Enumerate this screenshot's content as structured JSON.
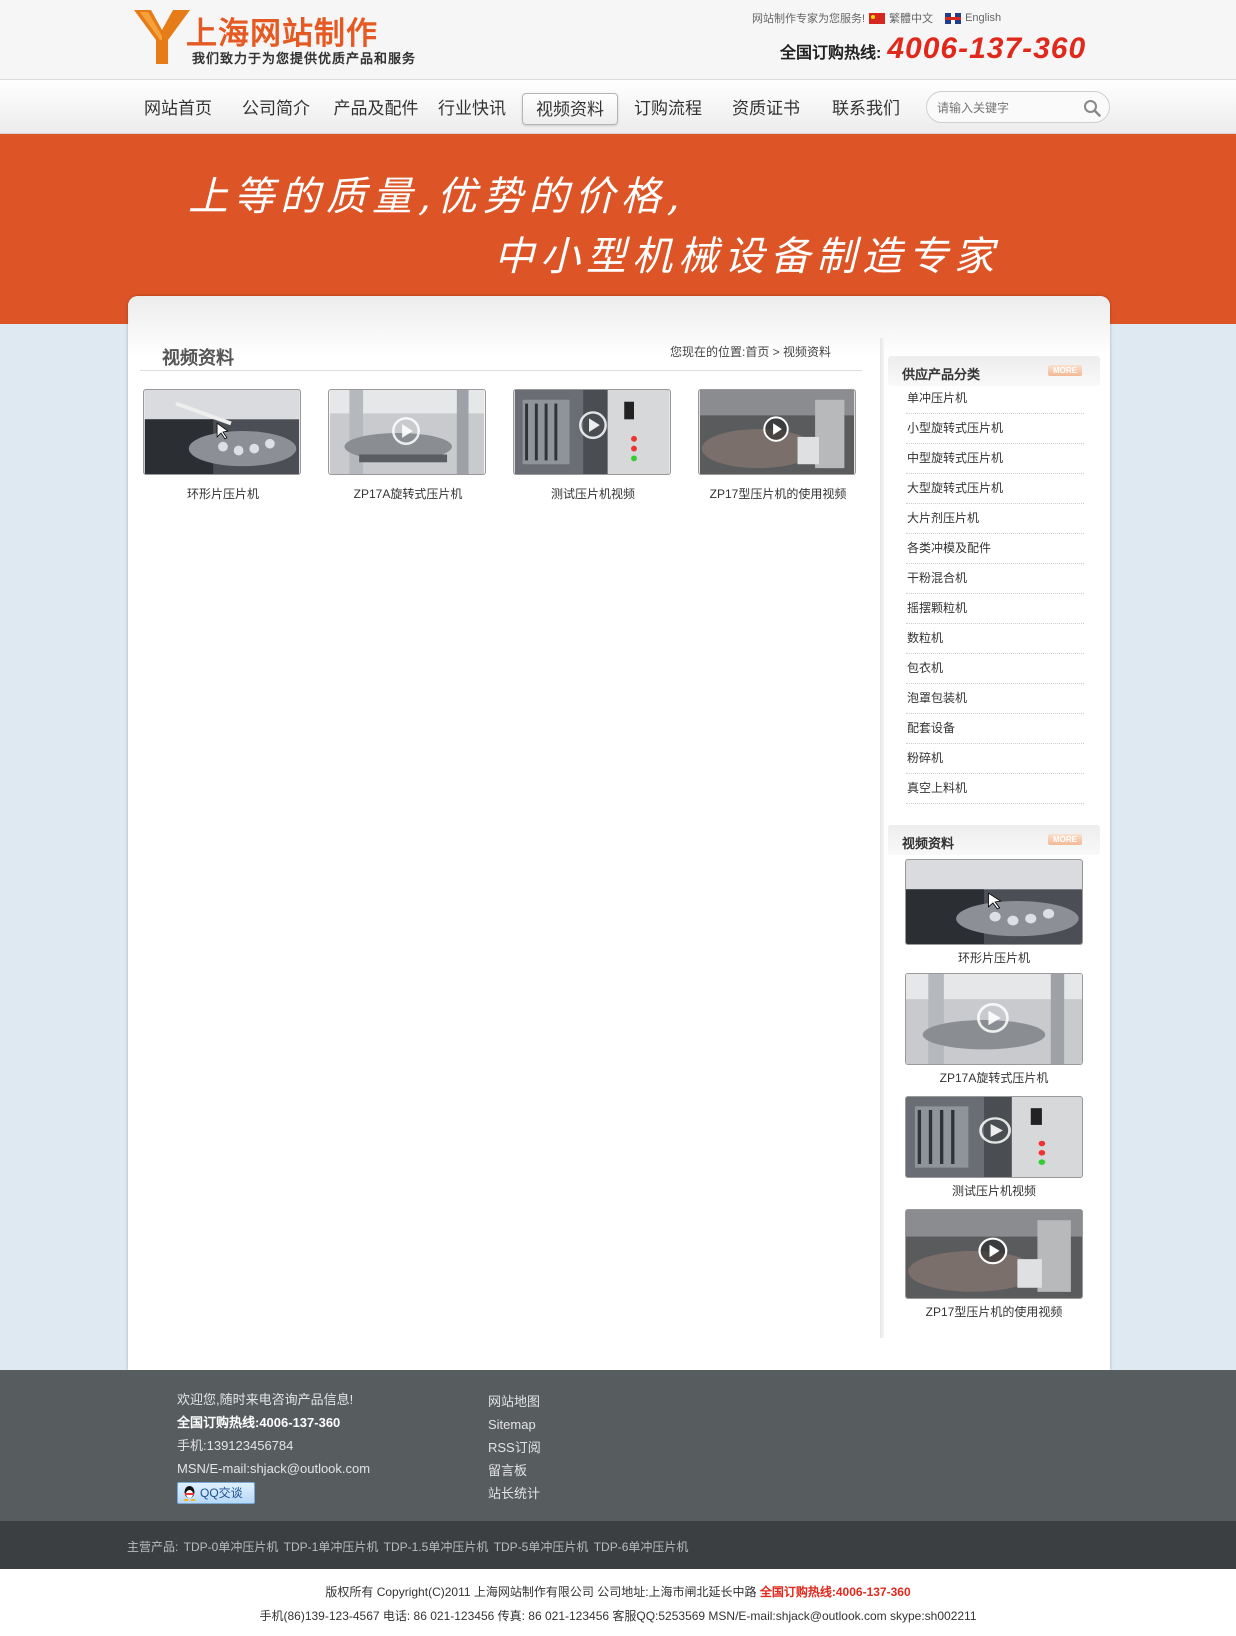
{
  "header": {
    "logo_title": "上海网站制作",
    "logo_sub": "我们致力于为您提供优质产品和服务",
    "service_text": "网站制作专家为您服务!",
    "lang_tc": "繁體中文",
    "lang_en": "English",
    "hotline_label": "全国订购热线:",
    "hotline_number": "4006-137-360"
  },
  "nav": {
    "items": [
      "网站首页",
      "公司简介",
      "产品及配件",
      "行业快讯",
      "视频资料",
      "订购流程",
      "资质证书",
      "联系我们"
    ],
    "active_index": 4,
    "search_placeholder": "请输入关键字"
  },
  "banner": {
    "line1": "上等的质量,优势的价格,",
    "line2": "中小型机械设备制造专家"
  },
  "main": {
    "title": "视频资料",
    "breadcrumb": "您现在的位置:首页 > 视频资料",
    "videos": [
      {
        "label": "环形片压片机",
        "icon": "cursor-icon"
      },
      {
        "label": "ZP17A旋转式压片机",
        "icon": "play-icon"
      },
      {
        "label": "测试压片机视频",
        "icon": "play-icon"
      },
      {
        "label": "ZP17型压片机的使用视频",
        "icon": "play-icon"
      }
    ]
  },
  "sidebar": {
    "categories_title": "供应产品分类",
    "more_label": "MORE",
    "categories": [
      "单冲压片机",
      "小型旋转式压片机",
      "中型旋转式压片机",
      "大型旋转式压片机",
      "大片剂压片机",
      "各类冲模及配件",
      "干粉混合机",
      "摇摆颗粒机",
      "数粒机",
      "包衣机",
      "泡罩包装机",
      "配套设备",
      "粉碎机",
      "真空上料机"
    ],
    "videos_title": "视频资料",
    "videos": [
      "环形片压片机",
      "ZP17A旋转式压片机",
      "测试压片机视频",
      "ZP17型压片机的使用视频"
    ]
  },
  "footer": {
    "welcome": "欢迎您,随时来电咨询产品信息!",
    "hotline": "全国订购热线:4006-137-360",
    "mobile": "手机:139123456784",
    "msn": "MSN/E-mail:shjack@outlook.com",
    "qq_label": "QQ交谈",
    "links": [
      "网站地图",
      "Sitemap",
      "RSS订阅",
      "留言板",
      "站长统计"
    ],
    "main_products": "主营产品: TDP-0单冲压片机  TDP-1单冲压片机   TDP-1.5单冲压片机  TDP-5单冲压片机  TDP-6单冲压片机",
    "copyright": "版权所有 Copyright(C)2011 上海网站制作有限公司 公司地址:上海市闸北延长中路",
    "copyright_hotline": "全国订购热线:4006-137-360",
    "contacts": "手机(86)139-123-4567 电话: 86 021-123456 传真: 86 021-123456 客服QQ:5253569 MSN/E-mail:shjack@outlook.com skype:sh002211"
  },
  "colors": {
    "brand_orange": "#dd5527",
    "hotline_red": "#e0281c",
    "footer_dark": "#575c5f"
  }
}
